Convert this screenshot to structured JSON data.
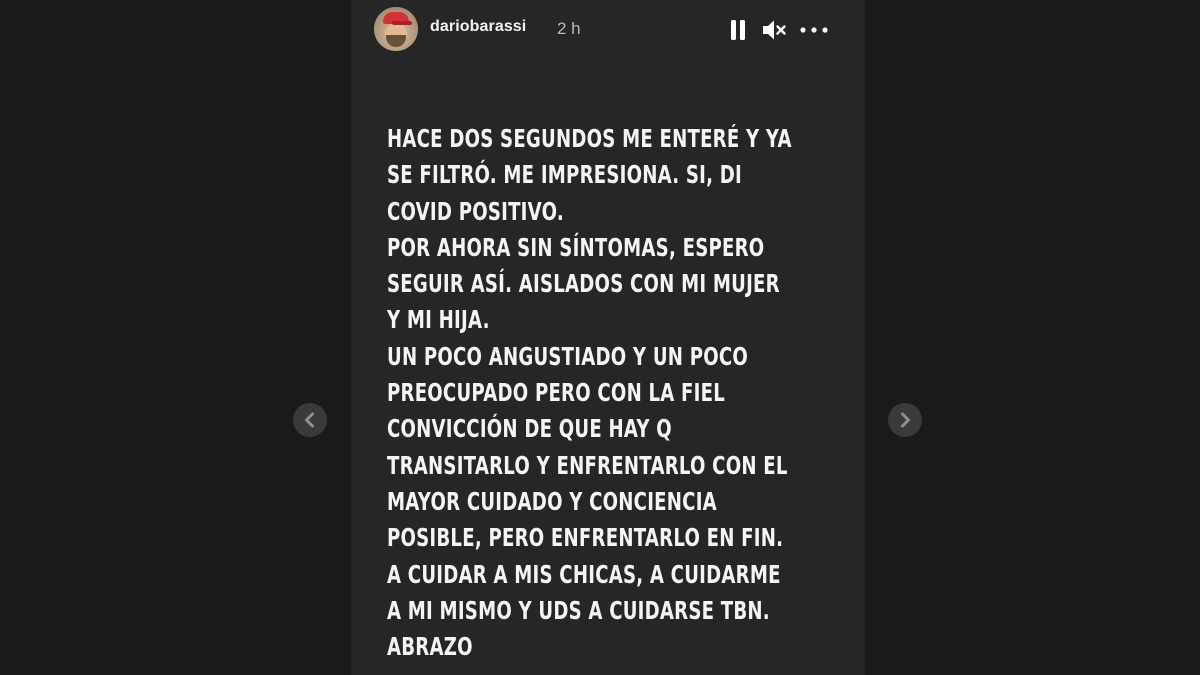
{
  "story": {
    "username": "dariobarassi",
    "timestamp": "2 h",
    "lines": [
      "HACE DOS SEGUNDOS ME ENTERÉ Y YA",
      "SE FILTRÓ. ME IMPRESIONA. SI, DI",
      "COVID POSITIVO.",
      "POR AHORA SIN SÍNTOMAS, ESPERO",
      "SEGUIR ASÍ. AISLADOS CON MI MUJER",
      "Y MI HIJA.",
      "UN POCO ANGUSTIADO Y UN POCO",
      "PREOCUPADO PERO CON LA FIEL",
      "CONVICCIÓN DE QUE HAY Q",
      "TRANSITARLO Y ENFRENTARLO CON EL",
      "MAYOR CUIDADO Y CONCIENCIA",
      "POSIBLE, PERO ENFRENTARLO EN FIN.",
      "A CUIDAR A MIS CHICAS, A CUIDARME",
      "A MI MISMO Y UDS A CUIDARSE TBN.",
      "ABRAZO"
    ]
  },
  "controls": {
    "pause_icon": "pause-icon",
    "mute_icon": "speaker-muted-icon",
    "more_icon": "more-horizontal-icon"
  },
  "navigation": {
    "prev_icon": "chevron-left-icon",
    "next_icon": "chevron-right-icon"
  },
  "colors": {
    "page_background": "#1a1a1a",
    "story_background": "#262626",
    "text": "#f4f4f4",
    "timestamp": "#b8b8b8",
    "nav_button": "#3a3a3a"
  }
}
